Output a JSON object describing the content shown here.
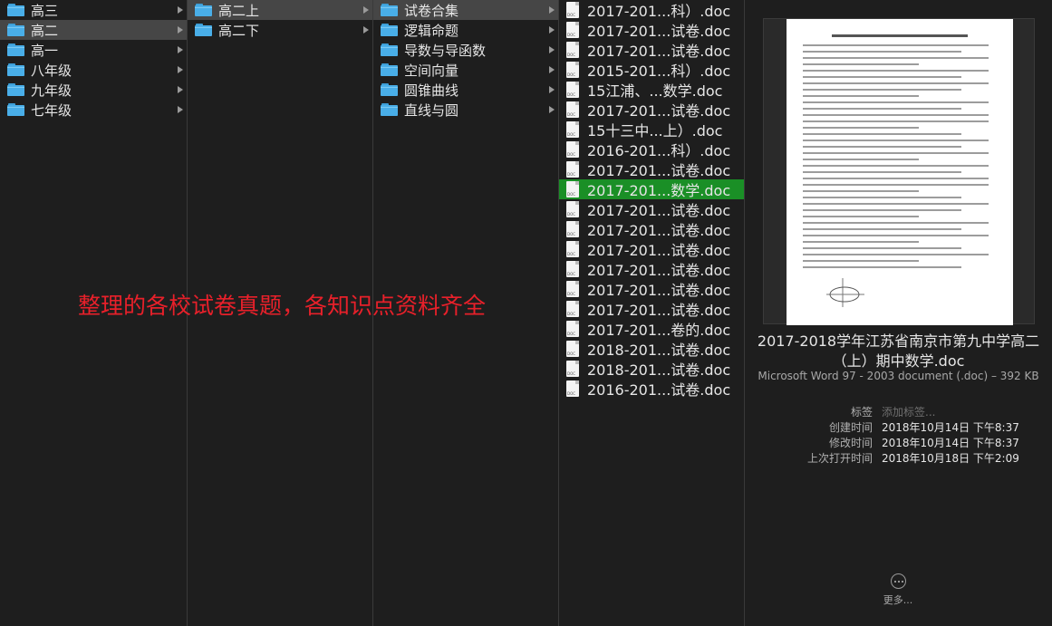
{
  "columns": {
    "col1": [
      {
        "label": "高三",
        "selected": false
      },
      {
        "label": "高二",
        "selected": true
      },
      {
        "label": "高一",
        "selected": false
      },
      {
        "label": "八年级",
        "selected": false
      },
      {
        "label": "九年级",
        "selected": false
      },
      {
        "label": "七年级",
        "selected": false
      }
    ],
    "col2": [
      {
        "label": "高二上",
        "selected": true
      },
      {
        "label": "高二下",
        "selected": false
      }
    ],
    "col3": [
      {
        "label": "试卷合集",
        "selected": true
      },
      {
        "label": "逻辑命题",
        "selected": false
      },
      {
        "label": "导数与导函数",
        "selected": false
      },
      {
        "label": "空间向量",
        "selected": false
      },
      {
        "label": "圆锥曲线",
        "selected": false
      },
      {
        "label": "直线与圆",
        "selected": false
      }
    ],
    "files": [
      {
        "label": "2017-201...科）.doc",
        "selected": false
      },
      {
        "label": "2017-201...试卷.doc",
        "selected": false
      },
      {
        "label": "2017-201...试卷.doc",
        "selected": false
      },
      {
        "label": "2015-201...科）.doc",
        "selected": false
      },
      {
        "label": "15江浦、...数学.doc",
        "selected": false
      },
      {
        "label": "2017-201...试卷.doc",
        "selected": false
      },
      {
        "label": "15十三中...上）.doc",
        "selected": false
      },
      {
        "label": "2016-201...科）.doc",
        "selected": false
      },
      {
        "label": "2017-201...试卷.doc",
        "selected": false
      },
      {
        "label": "2017-201...数学.doc",
        "selected": true
      },
      {
        "label": "2017-201...试卷.doc",
        "selected": false
      },
      {
        "label": "2017-201...试卷.doc",
        "selected": false
      },
      {
        "label": "2017-201...试卷.doc",
        "selected": false
      },
      {
        "label": "2017-201...试卷.doc",
        "selected": false
      },
      {
        "label": "2017-201...试卷.doc",
        "selected": false
      },
      {
        "label": "2017-201...试卷.doc",
        "selected": false
      },
      {
        "label": "2017-201...卷的.doc",
        "selected": false
      },
      {
        "label": "2018-201...试卷.doc",
        "selected": false
      },
      {
        "label": "2018-201...试卷.doc",
        "selected": false
      },
      {
        "label": "2016-201...试卷.doc",
        "selected": false
      }
    ]
  },
  "icons": {
    "folder": "folder-icon",
    "doc": "doc-file-icon",
    "chevron": "chevron-right-icon",
    "more": "more-icon"
  },
  "doc_badge": "DOC",
  "preview": {
    "filename": "2017-2018学年江苏省南京市第九中学高二（上）期中数学.doc",
    "kind": "Microsoft Word 97 - 2003 document (.doc)",
    "size": "392 KB",
    "tags_label": "标签",
    "tags_placeholder": "添加标签...",
    "created_label": "创建时间",
    "created": "2018年10月14日 下午8:37",
    "modified_label": "修改时间",
    "modified": "2018年10月14日 下午8:37",
    "opened_label": "上次打开时间",
    "opened": "2018年10月18日 下午2:09",
    "more_label": "更多..."
  },
  "overlay_text": "整理的各校试卷真题，各知识点资料齐全",
  "colors": {
    "background": "#1e1e1e",
    "selected_grey": "#464646",
    "selected_green": "#1a8f26",
    "folder_blue": "#49aee8",
    "overlay_red": "#e8202a"
  }
}
